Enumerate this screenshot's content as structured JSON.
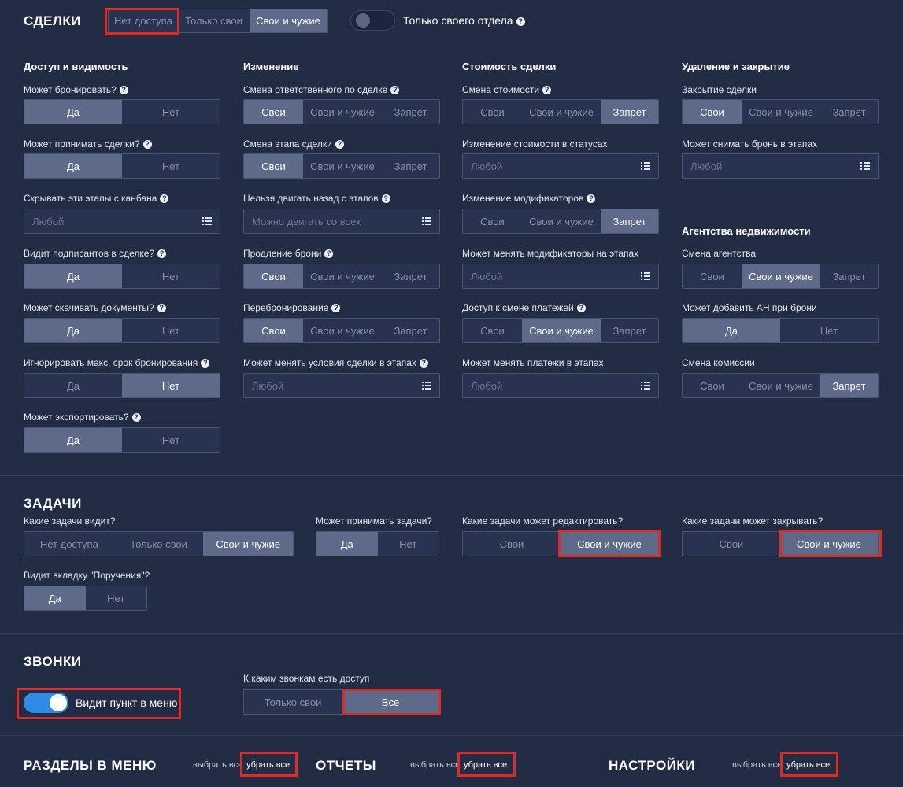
{
  "deals": {
    "title": "СДЕЛКИ",
    "scope_options": [
      "Нет доступа",
      "Только свои",
      "Свои и чужие"
    ],
    "dept_toggle_label": "Только своего отдела",
    "columns": {
      "access": "Доступ и видимость",
      "change": "Изменение",
      "cost": "Стоимость сделки",
      "delete": "Удаление и закрытие",
      "agency": "Агентства недвижимости"
    },
    "opts": {
      "yes": "Да",
      "no": "Нет",
      "own": "Свои",
      "own_other": "Свои и чужие",
      "forbid": "Запрет",
      "any": "Любой",
      "move_any": "Можно двигать со всех"
    },
    "fields": {
      "can_book": "Может бронировать?",
      "can_accept": "Может принимать сделки?",
      "hide_stages": "Скрывать эти этапы с канбана",
      "sees_signers": "Видит подписантов в сделке?",
      "can_download": "Может скачивать документы?",
      "ignore_max": "Игнорировать макс. срок бронирования",
      "can_export": "Может экспортировать?",
      "change_resp": "Смена ответственного по сделке",
      "change_stage": "Смена этапа сделки",
      "no_back": "Нельзя двигать назад с этапов",
      "extend_booking": "Продление брони",
      "rebooking": "Перебронирование",
      "change_terms": "Может менять условия сделки в этапах",
      "change_cost": "Смена стоимости",
      "cost_in_status": "Изменение стоимости в статусах",
      "change_mods": "Изменение модификаторов",
      "mods_in_stages": "Может менять модификаторы на этапах",
      "payments_access": "Доступ к смене платежей",
      "payments_in_stages": "Может менять платежи в этапах",
      "close_deal": "Закрытие сделки",
      "unbook_stages": "Может снимать бронь в этапах",
      "change_agency": "Смена агентства",
      "add_agency": "Может добавить АН при брони",
      "change_commission": "Смена комиссии"
    }
  },
  "tasks": {
    "title": "ЗАДАЧИ",
    "sees_label": "Какие задачи видит?",
    "sees_options": [
      "Нет доступа",
      "Только свои",
      "Свои и чужие"
    ],
    "accept_label": "Может принимать задачи?",
    "edit_label": "Какие задачи может редактировать?",
    "close_label": "Какие задачи может закрывать?",
    "orders_label": "Видит вкладку \"Поручения\"?"
  },
  "calls": {
    "title": "ЗВОНКИ",
    "menu_label": "Видит пункт в меню",
    "access_label": "К каким звонкам есть доступ",
    "access_options": [
      "Только свои",
      "Все"
    ]
  },
  "footer": {
    "menu_sections": "РАЗДЕЛЫ В МЕНЮ",
    "reports": "ОТЧЕТЫ",
    "settings": "НАСТРОЙКИ",
    "select_all": "выбрать все",
    "remove_all": "убрать все"
  },
  "colors": {
    "background": "#232c45",
    "active_segment": "#5d6a89",
    "highlight": "#e02a22",
    "toggle_on": "#2e8ce6"
  }
}
